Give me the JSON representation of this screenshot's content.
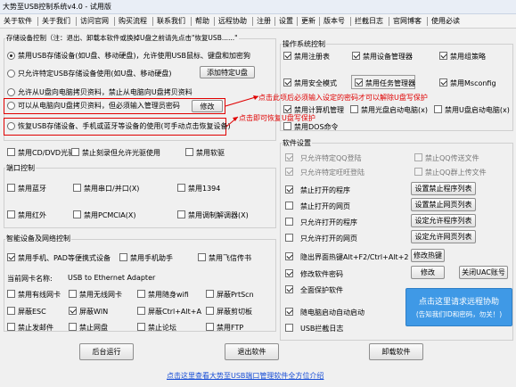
{
  "window": {
    "title": "大势至USB控制系统v4.0 - 试用版"
  },
  "menu": [
    "关于软件",
    "关于我们",
    "访问官网",
    "购买流程",
    "联系我们",
    "帮助",
    "远程协助",
    "注册",
    "设置",
    "更新",
    "版本号",
    "拦截日志",
    "官网博客",
    "使用必读"
  ],
  "storage": {
    "header": "存储设备控制（注：退出、卸载本软件或换掉U盘之前请先点击\"恢复USB......\"",
    "options": [
      {
        "label": "禁用USB存储设备(如U盘、移动硬盘)，允许使用USB鼠标、键盘和加密狗",
        "selected": true
      },
      {
        "label": "只允许特定USB存储设备使用(如U盘、移动硬盘)",
        "selected": false
      },
      {
        "label": "允许从U盘向电脑拷贝资料，禁止从电脑向U盘拷贝资料",
        "selected": false
      },
      {
        "label": "可以从电脑向U盘拷贝资料，但必须输入管理员密码",
        "selected": false
      },
      {
        "label": "恢复USB存储设备、手机或蓝牙等设备的使用(可手动点击恢复设备)",
        "selected": false
      }
    ],
    "add_button": "添加特定U盘",
    "modify_button": "修改"
  },
  "cd": {
    "items": [
      {
        "label": "禁用CD/DVD光驱",
        "checked": false
      },
      {
        "label": "禁止刻录但允许光驱使用",
        "checked": false
      },
      {
        "label": "禁用软驱",
        "checked": false
      }
    ]
  },
  "port": {
    "header": "端口控制",
    "items": [
      {
        "label": "禁用蓝牙",
        "checked": false
      },
      {
        "label": "禁用串口/并口(X)",
        "checked": false
      },
      {
        "label": "禁用1394",
        "checked": false
      },
      {
        "label": "禁用红外",
        "checked": false
      },
      {
        "label": "禁用PCMCIA(X)",
        "checked": false
      },
      {
        "label": "禁用调制解调器(X)",
        "checked": false
      }
    ]
  },
  "smart": {
    "header": "智能设备及网络控制",
    "items": [
      {
        "label": "禁用手机、PAD等便携式设备",
        "checked": true
      },
      {
        "label": "禁用手机助手",
        "checked": false
      },
      {
        "label": "禁用飞信传书",
        "checked": false
      }
    ]
  },
  "net": {
    "nic_label": "当前网卡名称:",
    "nic_value": "USB to Ethernet Adapter",
    "items": [
      {
        "label": "禁用有线网卡",
        "checked": false
      },
      {
        "label": "禁用无线网卡",
        "checked": false
      },
      {
        "label": "禁用随身wifi",
        "checked": false
      },
      {
        "label": "屏蔽PrtScn",
        "checked": false
      },
      {
        "label": "屏蔽ESC",
        "checked": false
      },
      {
        "label": "屏蔽WIN",
        "checked": true
      },
      {
        "label": "屏蔽Ctrl+Alt+A",
        "checked": false
      },
      {
        "label": "屏蔽剪切板",
        "checked": false
      },
      {
        "label": "禁止发邮件",
        "checked": false
      },
      {
        "label": "禁止网盘",
        "checked": false
      },
      {
        "label": "禁止论坛",
        "checked": false
      },
      {
        "label": "禁用FTP",
        "checked": false
      }
    ]
  },
  "os": {
    "header": "操作系统控制",
    "items": [
      {
        "label": "禁用注册表",
        "checked": true
      },
      {
        "label": "禁用设备管理器",
        "checked": true
      },
      {
        "label": "禁用组策略",
        "checked": true
      },
      {
        "label": "禁用安全模式",
        "checked": true
      },
      {
        "label": "禁用任务管理器",
        "checked": true
      },
      {
        "label": "禁用Msconfig",
        "checked": true
      },
      {
        "label": "禁用计算机管理",
        "checked": true
      },
      {
        "label": "禁用光盘启动电脑(x)",
        "checked": false
      },
      {
        "label": "禁用U盘启动电脑(x)",
        "checked": false
      },
      {
        "label": "禁用DOS命令",
        "checked": false
      }
    ]
  },
  "software": {
    "header": "软件设置",
    "items": [
      {
        "label": "只允许特定QQ登陆",
        "checked": true,
        "dim": true
      },
      {
        "label": "禁止QQ传送文件",
        "checked": false,
        "dim": true
      },
      {
        "label": "只允许特定旺旺登陆",
        "checked": true,
        "dim": true
      },
      {
        "label": "禁止QQ群上传文件",
        "checked": false,
        "dim": true
      },
      {
        "label": "禁止打开的程序",
        "checked": true,
        "dim": false
      },
      {
        "label": "禁止打开的网页",
        "checked": false,
        "dim": false
      },
      {
        "label": "只允许打开的程序",
        "checked": false,
        "dim": false
      },
      {
        "label": "只允许打开的网页",
        "checked": false,
        "dim": false
      },
      {
        "label": "隐出界面热键Alt+F2/Ctrl+Alt+2",
        "checked": true,
        "dim": false
      },
      {
        "label": "修改软件密码",
        "checked": true,
        "dim": false
      },
      {
        "label": "全面保护软件",
        "checked": true,
        "dim": false
      },
      {
        "label": "随电脑启动自动启动",
        "checked": true,
        "dim": false
      },
      {
        "label": "USB拦截日志",
        "checked": false,
        "dim": false
      }
    ],
    "buttons": {
      "program_list": "设置禁止程序列表",
      "web_list": "设置禁止网页列表",
      "allow_program": "设定允许程序列表",
      "allow_web": "设定允许网页列表",
      "hotkey": "修改热键",
      "modify": "修改",
      "close_uac": "关闭UAC账号"
    }
  },
  "bottom": {
    "run": "后台运行",
    "exit": "退出软件",
    "uninstall": "卸载软件"
  },
  "remote": {
    "line1": "点击这里请求远程协助",
    "line2": "(告知我们ID和密码，勿关！)"
  },
  "footer_link": "点击这里查看大势至USB端口管理软件全方位介绍",
  "annotations": {
    "a1": "点击此项后必须输入设定的密码才可以解除U盘写保护",
    "a2": "点击即可恢复U盘写保护"
  },
  "colors": {
    "accent_red": "#e00000",
    "link_blue": "#1a4fd6",
    "remote_blue": "#3f99e6"
  }
}
